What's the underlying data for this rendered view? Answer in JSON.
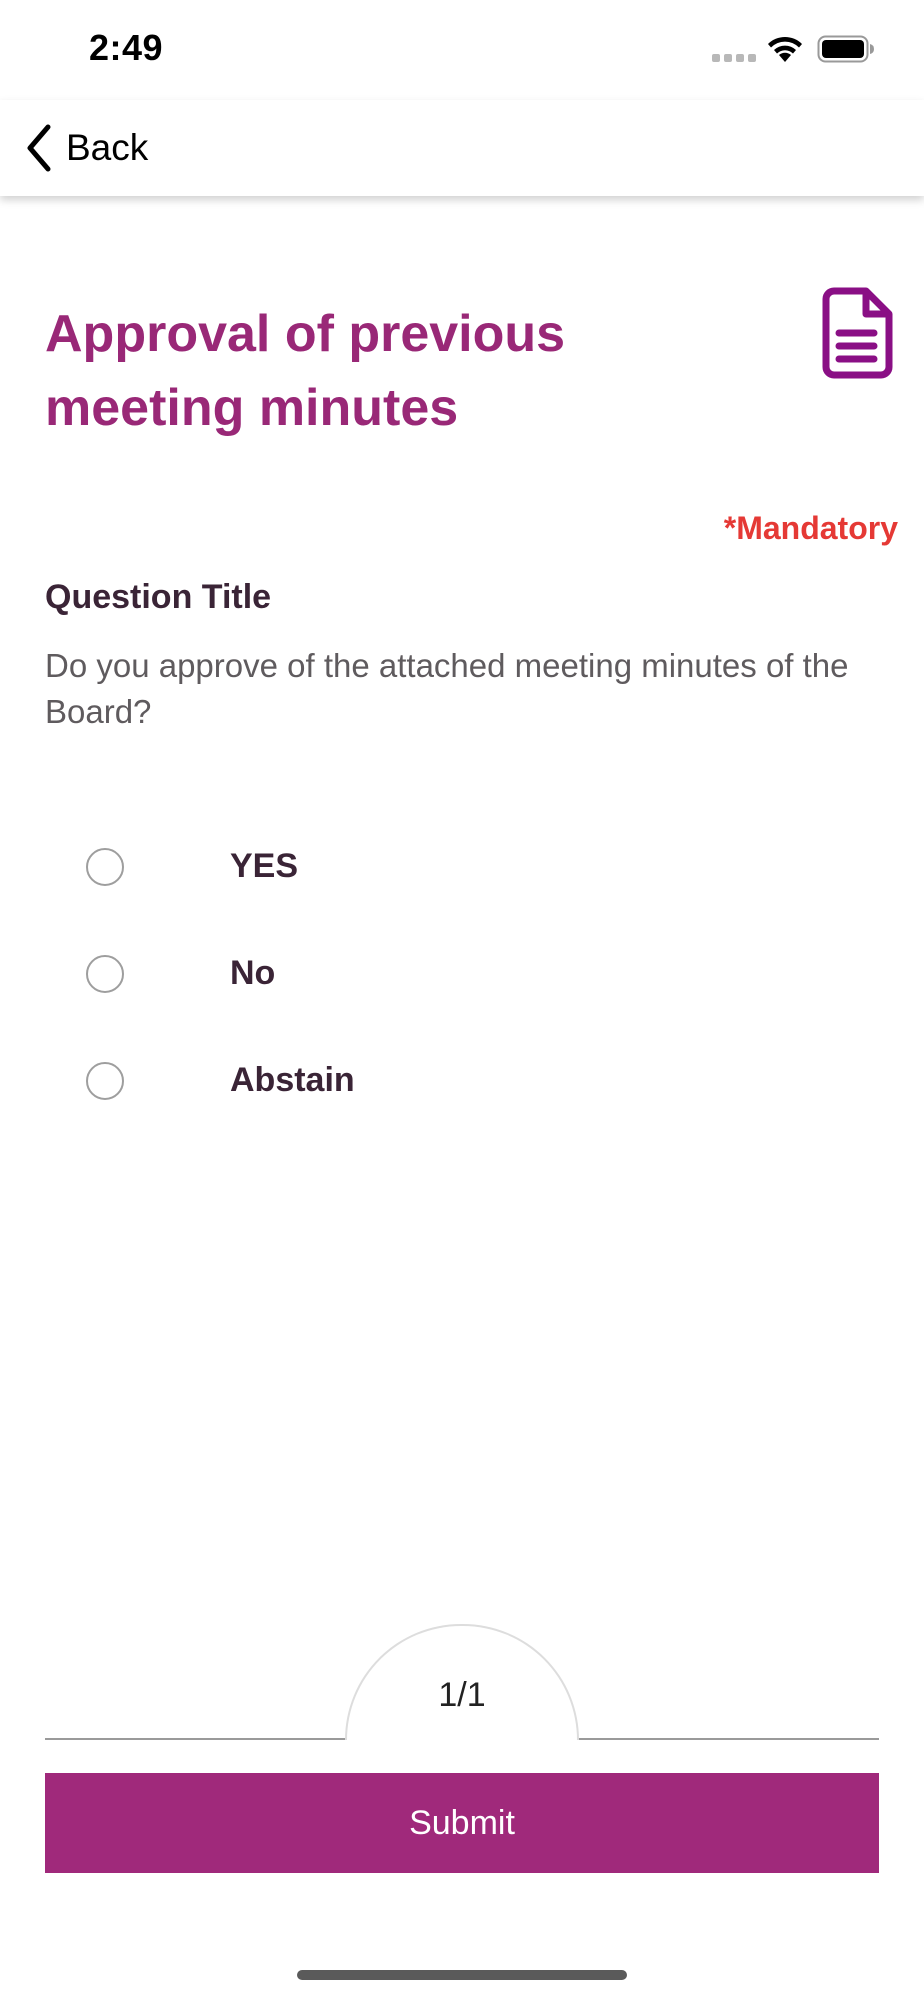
{
  "status_bar": {
    "time": "2:49",
    "icons": [
      "signal-icon",
      "wifi-icon",
      "battery-icon"
    ]
  },
  "nav": {
    "back_label": "Back",
    "back_icon": "chevron-left-icon"
  },
  "content": {
    "title": "Approval of previous meeting minutes",
    "attachment_icon": "document-icon",
    "mandatory_label": "*Mandatory",
    "question_heading": "Question Title",
    "question_text": "Do you approve of the attached meeting minutes of the Board?",
    "options": [
      {
        "label": "YES",
        "selected": false
      },
      {
        "label": "No",
        "selected": false
      },
      {
        "label": "Abstain",
        "selected": false
      }
    ]
  },
  "pager": {
    "text": "1/1"
  },
  "submit_label": "Submit",
  "colors": {
    "accent": "#992877",
    "button": "#a0297b",
    "mandatory": "#e53935",
    "icon": "#8a0f85"
  }
}
